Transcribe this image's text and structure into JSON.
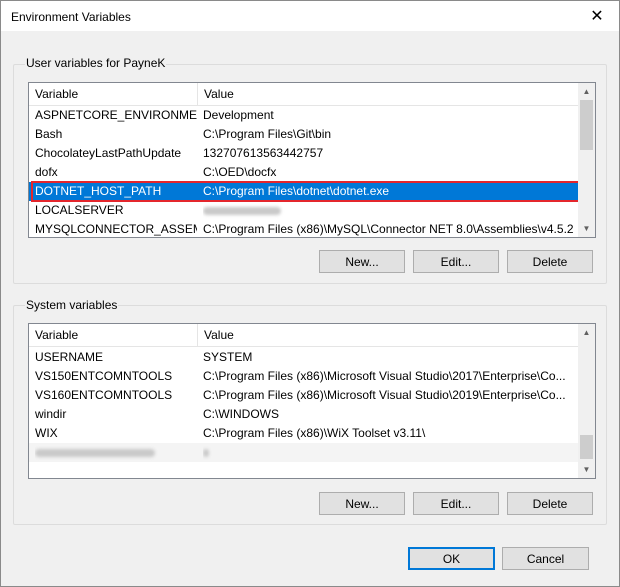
{
  "window": {
    "title": "Environment Variables"
  },
  "user_vars": {
    "group_label": "User variables for PayneK",
    "columns": [
      "Variable",
      "Value"
    ],
    "rows": [
      {
        "variable": "ASPNETCORE_ENVIRONMENT",
        "value": "Development"
      },
      {
        "variable": "Bash",
        "value": "C:\\Program Files\\Git\\bin"
      },
      {
        "variable": "ChocolateyLastPathUpdate",
        "value": "132707613563442757"
      },
      {
        "variable": "dofx",
        "value": "C:\\OED\\docfx"
      },
      {
        "variable": "DOTNET_HOST_PATH",
        "value": "C:\\Program Files\\dotnet\\dotnet.exe",
        "selected": true
      },
      {
        "variable": "LOCALSERVER",
        "value": "",
        "blurred_value": true
      },
      {
        "variable": "MYSQLCONNECTOR_ASSEM...",
        "value": "C:\\Program Files (x86)\\MySQL\\Connector NET 8.0\\Assemblies\\v4.5.2"
      }
    ],
    "buttons": {
      "new": "New...",
      "edit": "Edit...",
      "delete": "Delete"
    }
  },
  "system_vars": {
    "group_label": "System variables",
    "columns": [
      "Variable",
      "Value"
    ],
    "rows": [
      {
        "variable": "USERNAME",
        "value": "SYSTEM"
      },
      {
        "variable": "VS150ENTCOMNTOOLS",
        "value": "C:\\Program Files (x86)\\Microsoft Visual Studio\\2017\\Enterprise\\Co..."
      },
      {
        "variable": "VS160ENTCOMNTOOLS",
        "value": "C:\\Program Files (x86)\\Microsoft Visual Studio\\2019\\Enterprise\\Co..."
      },
      {
        "variable": "windir",
        "value": "C:\\WINDOWS"
      },
      {
        "variable": "WIX",
        "value": "C:\\Program Files (x86)\\WiX Toolset v3.11\\"
      },
      {
        "variable": "",
        "value": "",
        "blurred": true
      }
    ],
    "buttons": {
      "new": "New...",
      "edit": "Edit...",
      "delete": "Delete"
    }
  },
  "dialog_buttons": {
    "ok": "OK",
    "cancel": "Cancel"
  },
  "colors": {
    "selection": "#0078d7",
    "highlight_border": "#e4262c",
    "default_button_border": "#0078d7"
  },
  "icons": {
    "close": "close-icon",
    "scroll_up": "chevron-up-icon",
    "scroll_down": "chevron-down-icon"
  }
}
